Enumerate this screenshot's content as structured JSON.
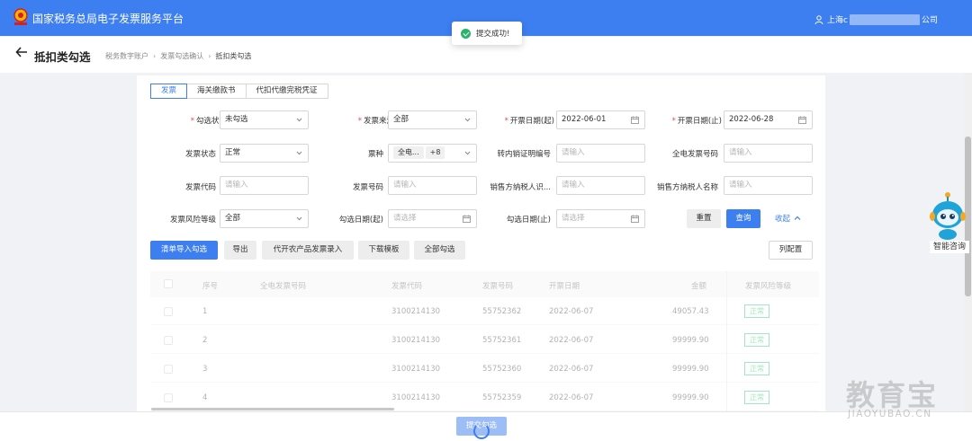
{
  "header": {
    "title": "国家税务总局电子发票服务平台",
    "user_prefix": "上海c",
    "user_suffix": "公司"
  },
  "toast": {
    "message": "提交成功!"
  },
  "page": {
    "title": "抵扣类勾选",
    "breadcrumb": [
      "税务数字账户",
      "发票勾选确认",
      "抵扣类勾选"
    ]
  },
  "tabs": [
    "发票",
    "海关缴款书",
    "代扣代缴完税凭证"
  ],
  "filters": {
    "selection_status": {
      "label": "勾选状态",
      "value": "未勾选"
    },
    "invoice_source": {
      "label": "发票来源",
      "value": "全部"
    },
    "issue_date_start": {
      "label": "开票日期(起)",
      "value": "2022-06-01"
    },
    "issue_date_end": {
      "label": "开票日期(止)",
      "value": "2022-06-28"
    },
    "invoice_status": {
      "label": "发票状态",
      "value": "正常"
    },
    "invoice_type": {
      "label": "票种",
      "chip": "全电...",
      "more": "+8"
    },
    "transfer_cert_no": {
      "label": "转内销证明编号",
      "placeholder": "请输入"
    },
    "digital_invoice_no": {
      "label": "全电发票号码",
      "placeholder": "请输入"
    },
    "invoice_code": {
      "label": "发票代码",
      "placeholder": "请输入"
    },
    "invoice_number": {
      "label": "发票号码",
      "placeholder": "请输入"
    },
    "seller_tax_id": {
      "label": "销售方纳税人识...",
      "placeholder": "请输入"
    },
    "seller_name": {
      "label": "销售方纳税人名称",
      "placeholder": "请输入"
    },
    "risk_level": {
      "label": "发票风险等级",
      "value": "全部"
    },
    "select_date_start": {
      "label": "勾选日期(起)",
      "placeholder": "请选择"
    },
    "select_date_end": {
      "label": "勾选日期(止)",
      "placeholder": "请选择"
    }
  },
  "buttons": {
    "reset": "重置",
    "query": "查询",
    "collapse": "收起",
    "list_import": "清单导入勾选",
    "export": "导出",
    "agri_entry": "代开农产品发票录入",
    "download_template": "下载模板",
    "select_all": "全部勾选",
    "column_config": "列配置",
    "submit": "提交勾选"
  },
  "table": {
    "headers": [
      "序号",
      "全电发票号码",
      "发票代码",
      "发票号码",
      "开票日期",
      "金额",
      "发票风险等级"
    ],
    "rows": [
      {
        "index": "1",
        "digital_no": "",
        "code": "3100214130",
        "number": "55752362",
        "date": "2022-06-07",
        "amount": "49057.43",
        "risk": "正常"
      },
      {
        "index": "2",
        "digital_no": "",
        "code": "3100214130",
        "number": "55752361",
        "date": "2022-06-07",
        "amount": "99999.90",
        "risk": "正常"
      },
      {
        "index": "3",
        "digital_no": "",
        "code": "3100214130",
        "number": "55752360",
        "date": "2022-06-07",
        "amount": "99999.90",
        "risk": "正常"
      },
      {
        "index": "4",
        "digital_no": "",
        "code": "3100214130",
        "number": "55752359",
        "date": "2022-06-07",
        "amount": "99999.90",
        "risk": "正常"
      }
    ]
  },
  "assistant": {
    "label": "智能咨询"
  },
  "watermark": {
    "main": "教育宝",
    "sub": "JIAOYUBAO.CN"
  },
  "colors": {
    "primary": "#3d7ff0",
    "success": "#2bb36a",
    "required": "#e34d4d"
  }
}
